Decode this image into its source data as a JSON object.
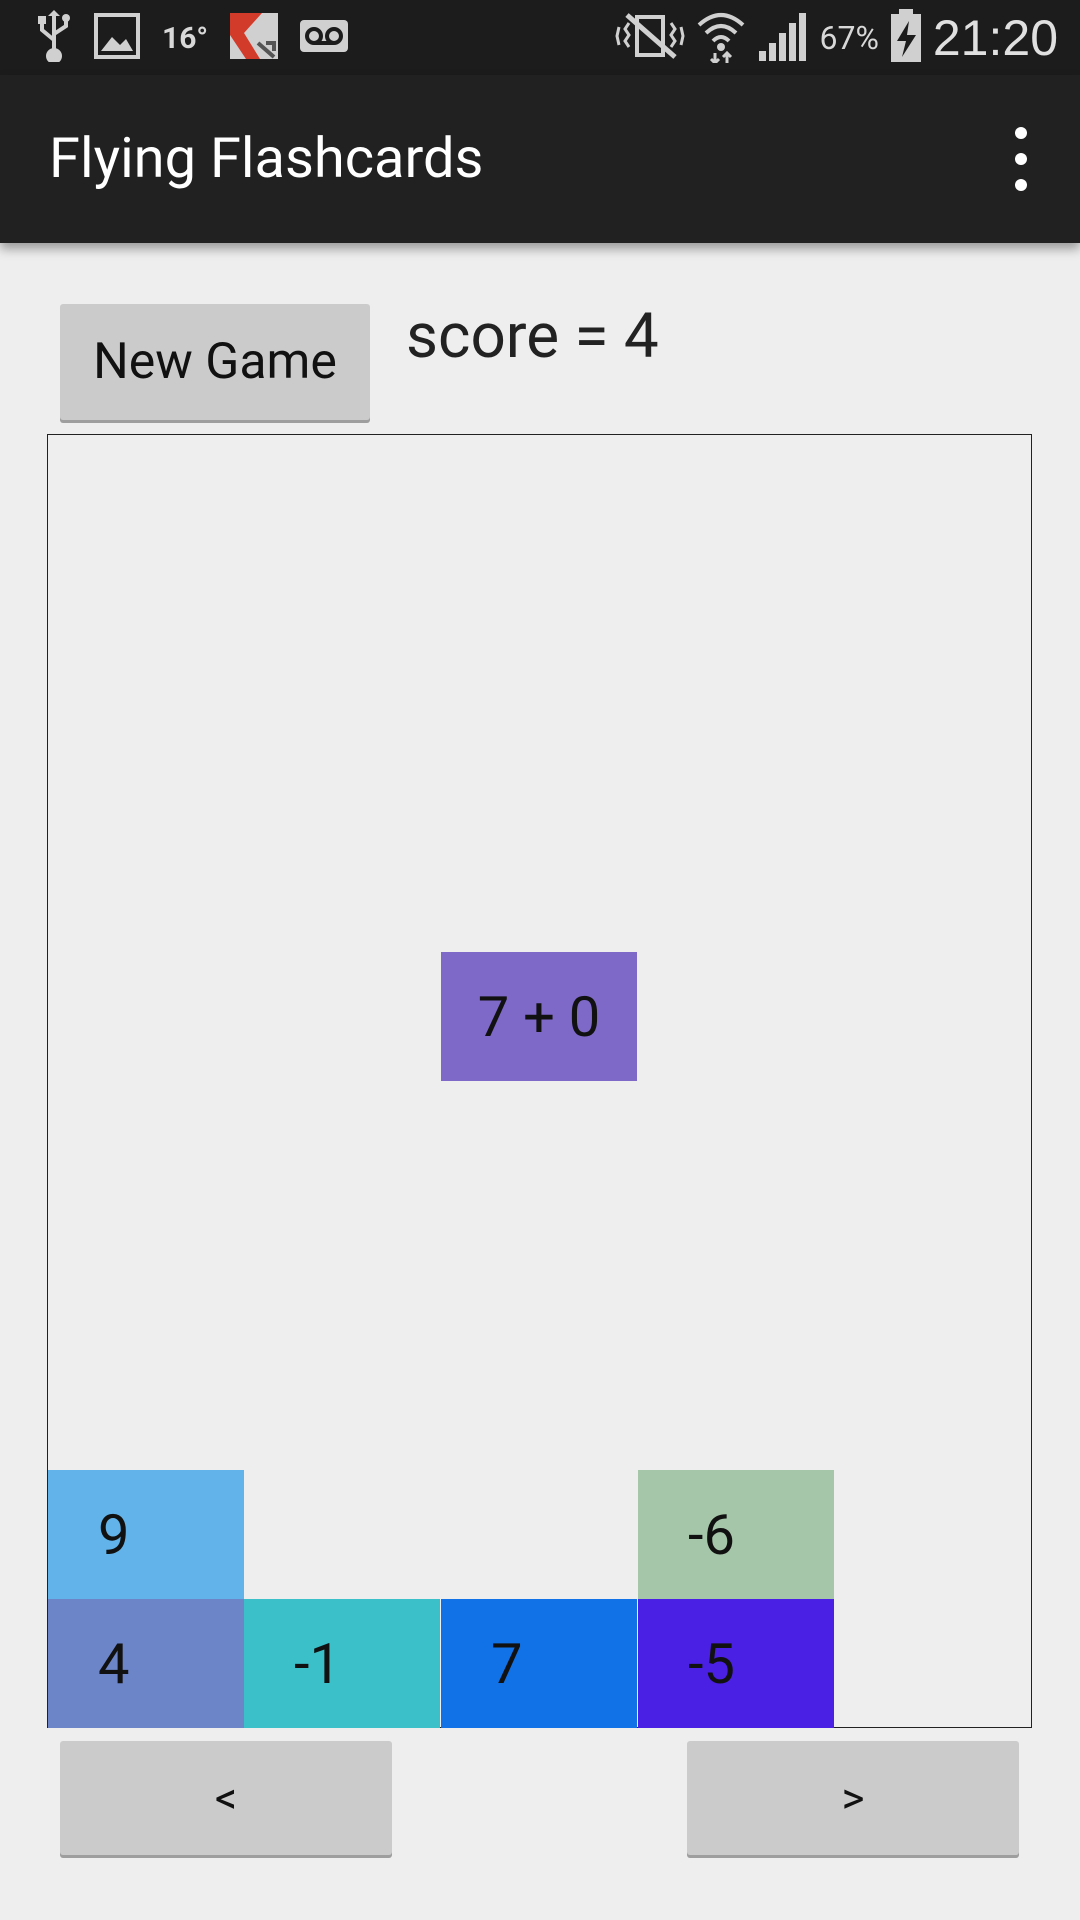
{
  "status_bar": {
    "temperature": "16°",
    "battery_percent": "67%",
    "clock": "21:20",
    "left_icons": [
      "usb-icon",
      "image-icon",
      "kaspersky-icon",
      "voicemail-icon"
    ],
    "right_icons": [
      "vibrate-icon",
      "wifi-icon",
      "signal-icon",
      "battery-charging-icon"
    ]
  },
  "app_bar": {
    "title": "Flying Flashcards",
    "overflow_icon": "overflow-menu-icon"
  },
  "controls": {
    "new_game_label": "New Game",
    "score_text": "score = 4",
    "prev_label": "<",
    "next_label": ">"
  },
  "board": {
    "falling_card": {
      "text": "7 + 0",
      "color": "#7e68c8"
    },
    "stacked_cards": [
      {
        "text": "9",
        "color": "#61b3e9"
      },
      {
        "text": "-6",
        "color": "#a6c6a9"
      },
      {
        "text": "4",
        "color": "#6c84c8"
      },
      {
        "text": "-1",
        "color": "#3bbfc9"
      },
      {
        "text": "7",
        "color": "#1172e7"
      },
      {
        "text": "-5",
        "color": "#4a20e4"
      }
    ]
  },
  "colors": {
    "status_bar_bg": "#1c1c1c",
    "action_bar_bg": "#212121",
    "page_bg": "#eeeeee",
    "button_bg": "#cbcbcb"
  }
}
